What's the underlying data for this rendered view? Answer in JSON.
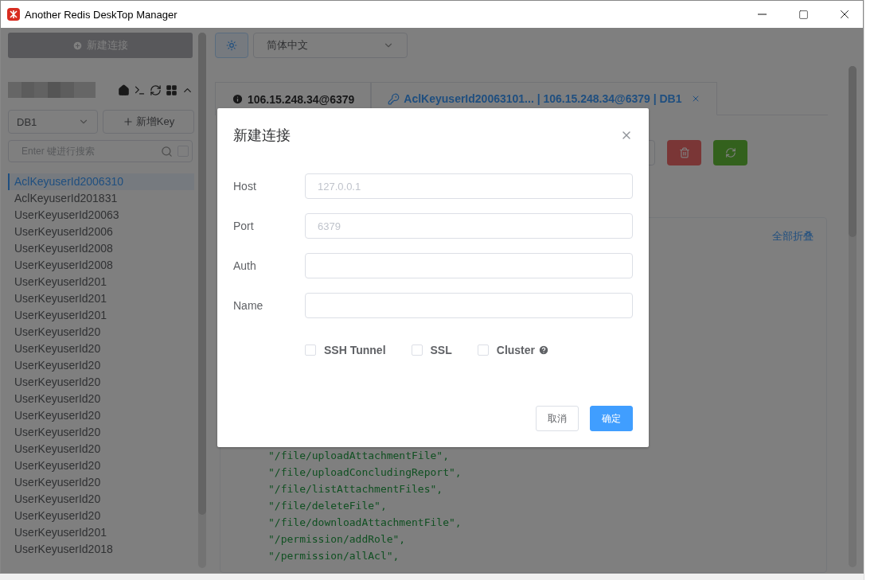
{
  "window": {
    "title": "Another Redis DeskTop Manager"
  },
  "sidebar": {
    "new_connection_button": "新建连接",
    "db_select": "DB1",
    "add_key_button": "新增Key",
    "search": {
      "placeholder": "Enter 键进行搜索",
      "checked": false
    },
    "keys": [
      {
        "name": "AclKeyuserId2006310",
        "selected": true
      },
      {
        "name": "AclKeyuserId201831",
        "selected": false
      },
      {
        "name": "UserKeyuserId20063",
        "selected": false
      },
      {
        "name": "UserKeyuserId2006",
        "selected": false
      },
      {
        "name": "UserKeyuserId2008",
        "selected": false
      },
      {
        "name": "UserKeyuserId2008",
        "selected": false
      },
      {
        "name": "UserKeyuserId201",
        "selected": false
      },
      {
        "name": "UserKeyuserId201",
        "selected": false
      },
      {
        "name": "UserKeyuserId201",
        "selected": false
      },
      {
        "name": "UserKeyuserId20",
        "selected": false
      },
      {
        "name": "UserKeyuserId20",
        "selected": false
      },
      {
        "name": "UserKeyuserId20",
        "selected": false
      },
      {
        "name": "UserKeyuserId20",
        "selected": false
      },
      {
        "name": "UserKeyuserId20",
        "selected": false
      },
      {
        "name": "UserKeyuserId20",
        "selected": false
      },
      {
        "name": "UserKeyuserId20",
        "selected": false
      },
      {
        "name": "UserKeyuserId20",
        "selected": false
      },
      {
        "name": "UserKeyuserId20",
        "selected": false
      },
      {
        "name": "UserKeyuserId20",
        "selected": false
      },
      {
        "name": "UserKeyuserId20",
        "selected": false
      },
      {
        "name": "UserKeyuserId20",
        "selected": false
      },
      {
        "name": "UserKeyuserId201",
        "selected": false
      },
      {
        "name": "UserKeyuserId2018",
        "selected": false
      }
    ]
  },
  "main": {
    "language_select": "简体中文",
    "tabs": [
      {
        "kind": "info",
        "label": "106.15.248.34@6379",
        "selected": false
      },
      {
        "kind": "key",
        "label": "AclKeyuserId20063101... | 106.15.248.34@6379 | DB1",
        "selected": true
      }
    ],
    "collapse_all_link": "全部折叠",
    "code_lines": [
      "\"/file/uploadAttachmentFile\",",
      "\"/file/uploadConcludingReport\",",
      "\"/file/listAttachmentFiles\",",
      "\"/file/deleteFile\",",
      "\"/file/downloadAttachmentFile\",",
      "\"/permission/addRole\",",
      "\"/permission/allAcl\","
    ]
  },
  "dialog": {
    "title": "新建连接",
    "fields": [
      {
        "label": "Host",
        "placeholder": "127.0.0.1"
      },
      {
        "label": "Port",
        "placeholder": "6379"
      },
      {
        "label": "Auth"
      },
      {
        "label": "Name"
      }
    ],
    "options": [
      {
        "label": "SSH Tunnel",
        "checked": false
      },
      {
        "label": "SSL",
        "checked": false
      },
      {
        "label": "Cluster",
        "checked": false,
        "help": true
      }
    ],
    "buttons": [
      {
        "label": "取消",
        "kind": "default"
      },
      {
        "label": "确定",
        "kind": "primary"
      }
    ]
  }
}
